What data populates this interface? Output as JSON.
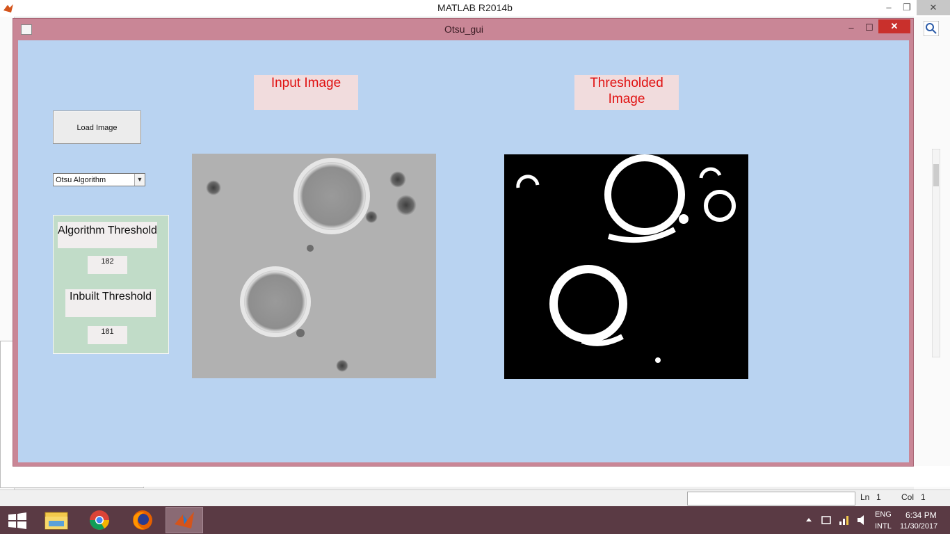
{
  "matlab": {
    "title": "MATLAB R2014b",
    "controls": {
      "minimize": "–",
      "maximize": "❐",
      "close": "✕"
    },
    "status": {
      "ln_label": "Ln",
      "ln_value": "1",
      "col_label": "Col",
      "col_value": "1"
    }
  },
  "figure": {
    "title": "Otsu_gui",
    "controls": {
      "minimize": "–",
      "maximize": "☐",
      "close": "✕"
    },
    "input_image_label": "Input Image",
    "output_image_label": "Thresholded Image",
    "load_button_label": "Load Image",
    "algorithm_select_value": "Otsu Algorithm",
    "algorithm_threshold_label": "Algorithm Threshold",
    "algorithm_threshold_value": "182",
    "inbuilt_threshold_label": "Inbuilt Threshold",
    "inbuilt_threshold_value": "181"
  },
  "taskbar": {
    "apps": [
      "file-explorer-icon",
      "chrome-icon",
      "firefox-icon",
      "matlab-icon"
    ],
    "lang_line1": "ENG",
    "lang_line2": "INTL",
    "time": "6:34 PM",
    "date": "11/30/2017"
  },
  "colors": {
    "figure_frame": "#c98696",
    "figure_background": "#b9d3f1",
    "label_text": "#e01010",
    "threshold_panel": "#c1dcc8"
  }
}
